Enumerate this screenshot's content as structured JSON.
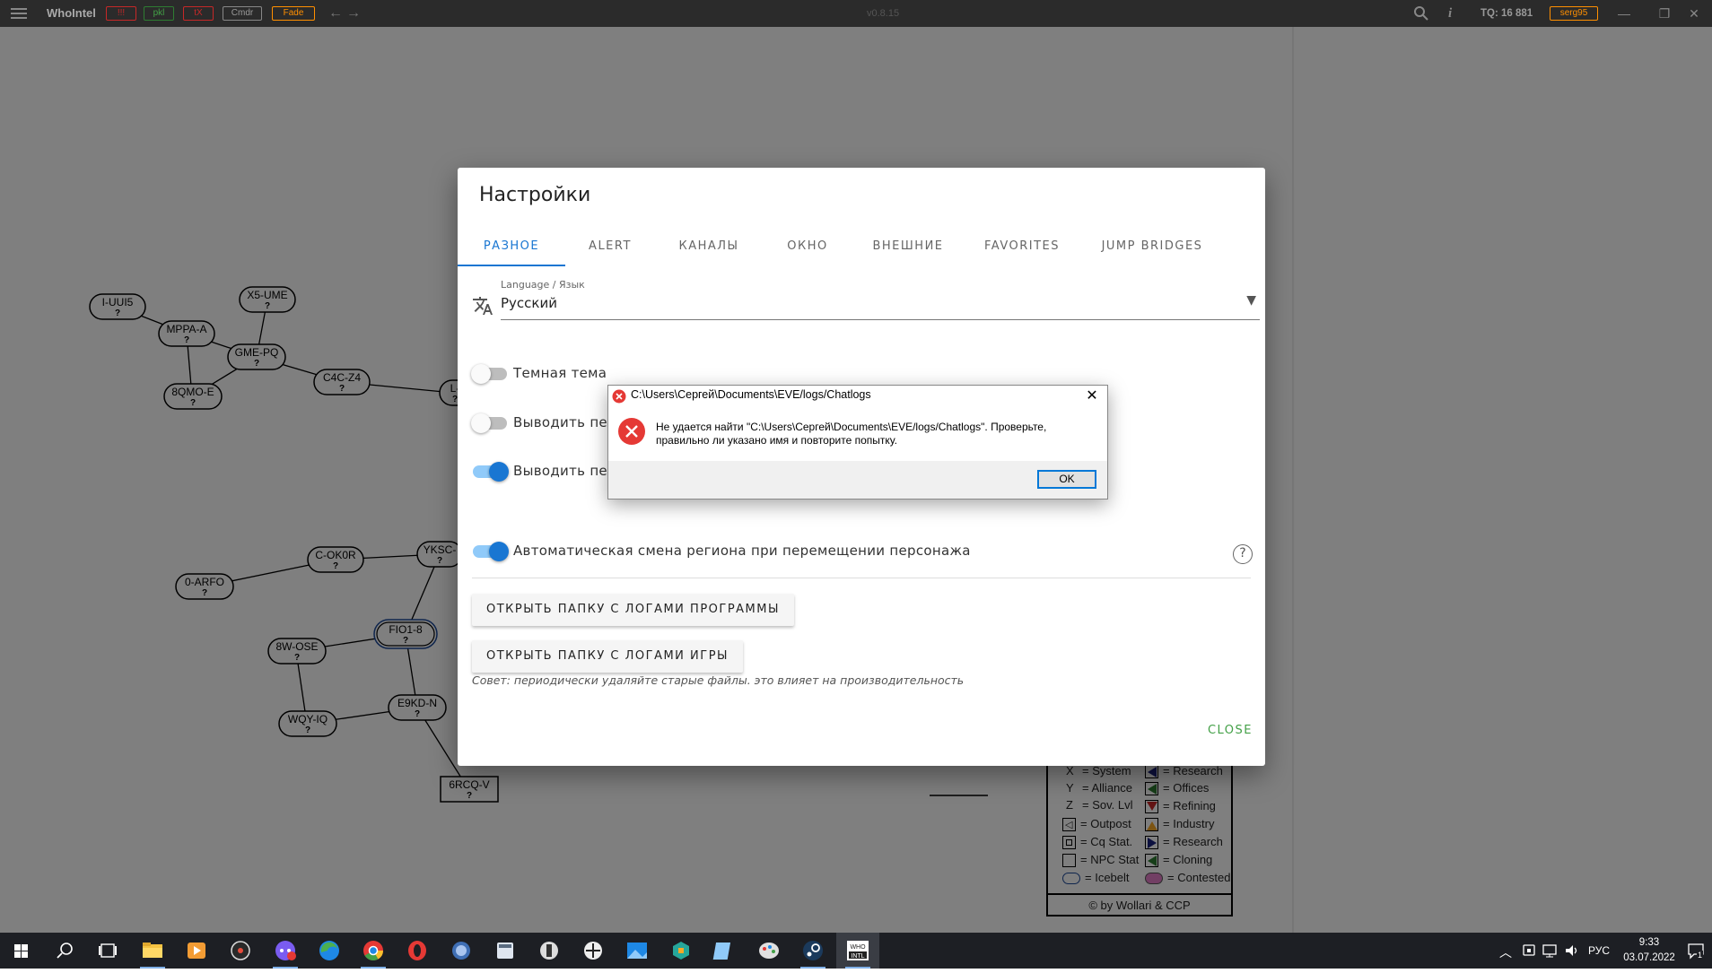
{
  "titlebar": {
    "app_name": "WhoIntel",
    "tags": [
      {
        "label": "!!!",
        "color": "#e53935"
      },
      {
        "label": "pkl",
        "color": "#43a047"
      },
      {
        "label": "tX",
        "color": "#e53935"
      },
      {
        "label": "Cmdr",
        "color": "#aaaaaa"
      },
      {
        "label": "Fade",
        "color": "#ffb300"
      }
    ],
    "version": "v0.8.15",
    "tq": "TQ: 16 881",
    "user_tag": "serg95"
  },
  "map": {
    "systems": [
      {
        "name": "I-UUI5",
        "q": "?"
      },
      {
        "name": "X5-UME",
        "q": "?"
      },
      {
        "name": "MPPA-A",
        "q": "?"
      },
      {
        "name": "GME-PQ",
        "q": "?"
      },
      {
        "name": "C4C-Z4",
        "q": "?"
      },
      {
        "name": "8QMO-E",
        "q": "?"
      },
      {
        "name": "L-",
        "q": "?"
      },
      {
        "name": "C-OK0R",
        "q": "?"
      },
      {
        "name": "YKSC-",
        "q": "?"
      },
      {
        "name": "0-ARFO",
        "q": "?"
      },
      {
        "name": "FIO1-8",
        "q": "?"
      },
      {
        "name": "8W-OSE",
        "q": "?"
      },
      {
        "name": "WQY-IQ",
        "q": "?"
      },
      {
        "name": "E9KD-N",
        "q": "?"
      },
      {
        "name": "6RCQ-V",
        "q": "?"
      }
    ]
  },
  "legend": {
    "left": [
      {
        "key": "X",
        "text": "= System"
      },
      {
        "key": "Y",
        "text": "= Alliance"
      },
      {
        "key": "Z",
        "text": "= Sov. Lvl"
      },
      {
        "icon": "outpost-icon",
        "text": "= Outpost"
      },
      {
        "icon": "cq-station-icon",
        "text": "= Cq Stat."
      },
      {
        "icon": "npc-station-icon",
        "text": "= NPC Stat"
      },
      {
        "icon": "icebelt-icon",
        "text": "= Icebelt"
      }
    ],
    "right": [
      {
        "icon": "research-icon",
        "color": "#1a237e",
        "text": "= Research"
      },
      {
        "icon": "offices-icon",
        "color": "#2e7d32",
        "text": "= Offices"
      },
      {
        "icon": "refining-icon",
        "color": "#c62828",
        "text": "= Refining"
      },
      {
        "icon": "industry-icon",
        "color": "#f9a825",
        "text": "= Industry"
      },
      {
        "icon": "research-icon",
        "color": "#1a237e",
        "text": "= Research"
      },
      {
        "icon": "cloning-icon",
        "color": "#2e7d32",
        "text": "= Cloning"
      },
      {
        "icon": "contested-icon",
        "color": "#e57ec8",
        "text": "= Contested"
      }
    ],
    "footer": "© by Wollari & CCP"
  },
  "settings": {
    "title": "Настройки",
    "tabs": [
      "РАЗНОЕ",
      "ALERT",
      "КАНАЛЫ",
      "ОКНО",
      "ВНЕШНИЕ",
      "FAVORITES",
      "JUMP BRIDGES"
    ],
    "active_tab": 0,
    "language": {
      "label": "Language / Язык",
      "value": "Русский"
    },
    "options": [
      {
        "label": "Темная тема",
        "on": false
      },
      {
        "label": "Выводить пере",
        "on": false
      },
      {
        "label": "Выводить пере",
        "on": true
      },
      {
        "label": "Автоматическая смена региона при перемещении персонажа",
        "on": true
      }
    ],
    "btn_program_logs": "ОТКРЫТЬ ПАПКУ С ЛОГАМИ ПРОГРАММЫ",
    "btn_game_logs": "ОТКРЫТЬ ПАПКУ С ЛОГАМИ ИГРЫ",
    "tip": "Совет: периодически удаляйте старые файлы. это влияет на производительность",
    "close": "CLOSE",
    "accent": "#1976d2"
  },
  "error_dialog": {
    "title": "C:\\Users\\Сергей\\Documents\\EVE/logs/Chatlogs",
    "message": "Не удается найти \"C:\\Users\\Сергей\\Documents\\EVE/logs/Chatlogs\". Проверьте, правильно ли указано имя и повторите попытку.",
    "ok": "OK"
  },
  "taskbar": {
    "language": "РУС",
    "time": "9:33",
    "date": "03.07.2022",
    "notifications": "1"
  }
}
